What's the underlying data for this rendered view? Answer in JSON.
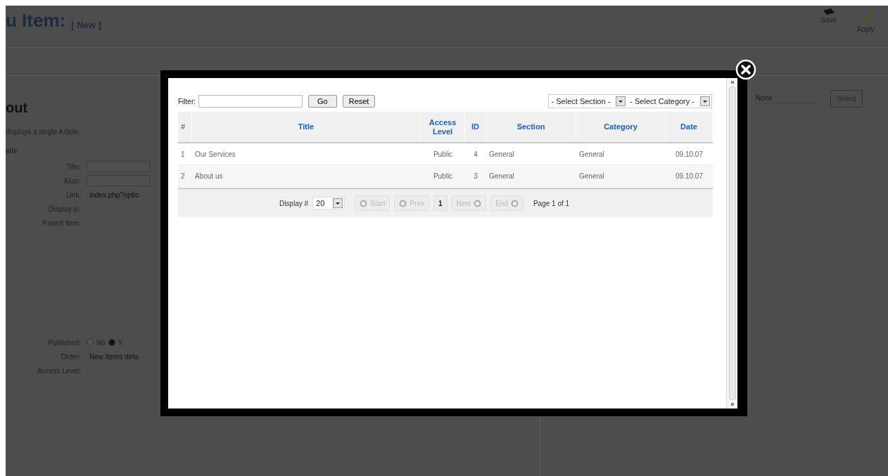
{
  "page": {
    "title": "u Item:",
    "title_tag": "[ New ]",
    "toolbar": [
      {
        "label": "Save",
        "kind": "save"
      },
      {
        "label": "Apply",
        "kind": "apply"
      }
    ],
    "heading": "out",
    "description": "displays a single Article.",
    "fieldset": "ails",
    "fields": [
      {
        "label": "Title:",
        "kind": "input"
      },
      {
        "label": "Alias:",
        "kind": "input"
      },
      {
        "label": "Link:",
        "kind": "text",
        "value": "index.php?optio"
      },
      {
        "label": "Display in:",
        "kind": "text"
      },
      {
        "label": "Parent Item:",
        "kind": "tall"
      },
      {
        "label": "Published:",
        "kind": "radio",
        "options": [
          {
            "label": "No",
            "selected": false
          },
          {
            "label": "Y",
            "selected": true
          }
        ]
      },
      {
        "label": "Order:",
        "kind": "text",
        "value": "New Items defa"
      },
      {
        "label": "Access Level:",
        "kind": "text"
      }
    ],
    "right_field": {
      "value": "None",
      "button": "Select"
    }
  },
  "modal": {
    "filter": {
      "label": "Filter:",
      "go": "Go",
      "reset": "Reset"
    },
    "selects": [
      "- Select Section -",
      "- Select Category -"
    ],
    "columns": [
      "#",
      "Title",
      "Access Level",
      "ID",
      "Section",
      "Category",
      "Date"
    ],
    "rows": [
      [
        "1",
        "Our Services",
        "Public",
        "4",
        "General",
        "General",
        "09.10.07"
      ],
      [
        "2",
        "About us",
        "Public",
        "3",
        "General",
        "General",
        "09.10.07"
      ]
    ],
    "pagination": {
      "display_label": "Display #",
      "display_value": "20",
      "buttons": [
        {
          "label": "Start",
          "kind": "back"
        },
        {
          "label": "Prev",
          "kind": "back"
        },
        {
          "label": "1",
          "kind": "number"
        },
        {
          "label": "Next",
          "kind": "forward"
        },
        {
          "label": "End",
          "kind": "forward"
        }
      ],
      "page_info": "Page 1 of 1"
    }
  }
}
